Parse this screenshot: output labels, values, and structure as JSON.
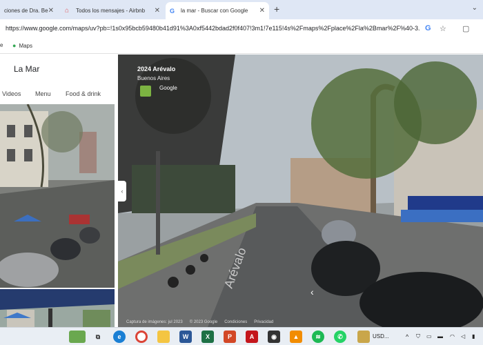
{
  "browser": {
    "tabs": [
      {
        "label": "ciones de Dra. Be"
      },
      {
        "label": "Todos los mensajes - Airbnb"
      },
      {
        "label": "la mar - Buscar con Google"
      }
    ],
    "new_tab": "+",
    "url": "https://www.google.com/maps/uv?pb=!1s0x95bcb59480b41d91%3A0xf5442bdad2f0f407!3m1!7e115!4s%2Fmaps%2Fplace%2Fla%2Bmar%2F%40-3...",
    "bookmarks": [
      {
        "label": "e"
      },
      {
        "label": "Maps"
      }
    ]
  },
  "panel": {
    "title": "La Mar",
    "tabs": [
      "Videos",
      "Menu",
      "Food & drink"
    ]
  },
  "streetview": {
    "title": "2024 Arévalo",
    "subtitle": "Buenos Aires",
    "brand": "Google",
    "street_label": "Arévalo",
    "footer": [
      "Captura de imágenes: jul 2023",
      "© 2023 Google",
      "Condiciones",
      "Privacidad"
    ]
  },
  "taskbar": {
    "tray_text": "USD..."
  }
}
